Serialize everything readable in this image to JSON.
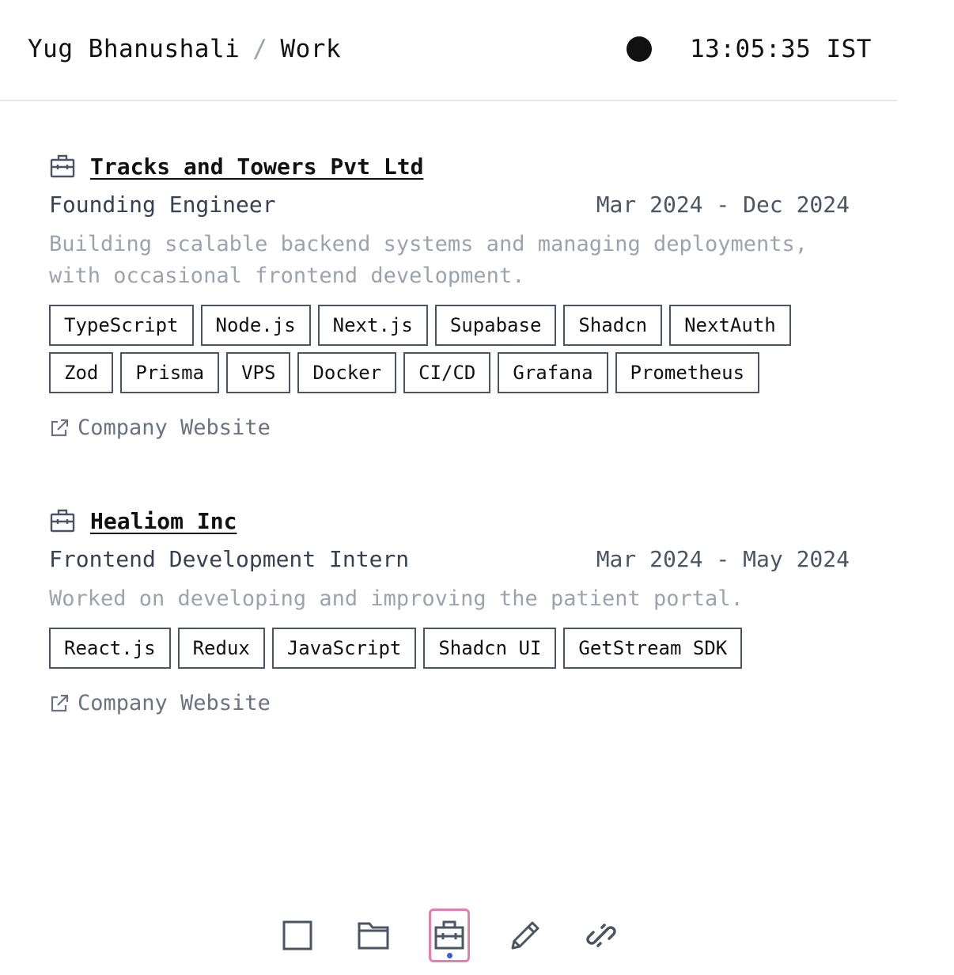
{
  "header": {
    "name": "Yug Bhanushali",
    "separator": "/",
    "section": "Work",
    "clock": "13:05:35 IST"
  },
  "jobs": [
    {
      "company": "Tracks and Towers Pvt Ltd",
      "role": "Founding Engineer",
      "dates": "Mar 2024 - Dec 2024",
      "description": "Building scalable backend systems and managing deployments, with occasional frontend development.",
      "tags": [
        "TypeScript",
        "Node.js",
        "Next.js",
        "Supabase",
        "Shadcn",
        "NextAuth",
        "Zod",
        "Prisma",
        "VPS",
        "Docker",
        "CI/CD",
        "Grafana",
        "Prometheus"
      ],
      "link_label": "Company Website"
    },
    {
      "company": "Healiom Inc",
      "role": "Frontend Development Intern",
      "dates": "Mar 2024 - May 2024",
      "description": "Worked on developing and improving the patient portal.",
      "tags": [
        "React.js",
        "Redux",
        "JavaScript",
        "Shadcn UI",
        "GetStream SDK"
      ],
      "link_label": "Company Website"
    }
  ],
  "dock": {
    "items": [
      {
        "icon": "square-icon",
        "active": false
      },
      {
        "icon": "folder-icon",
        "active": false
      },
      {
        "icon": "briefcase-icon",
        "active": true
      },
      {
        "icon": "pencil-icon",
        "active": false
      },
      {
        "icon": "link-icon",
        "active": false
      }
    ],
    "active_color": "#e27fb0",
    "indicator_color": "#3b5bdb"
  }
}
